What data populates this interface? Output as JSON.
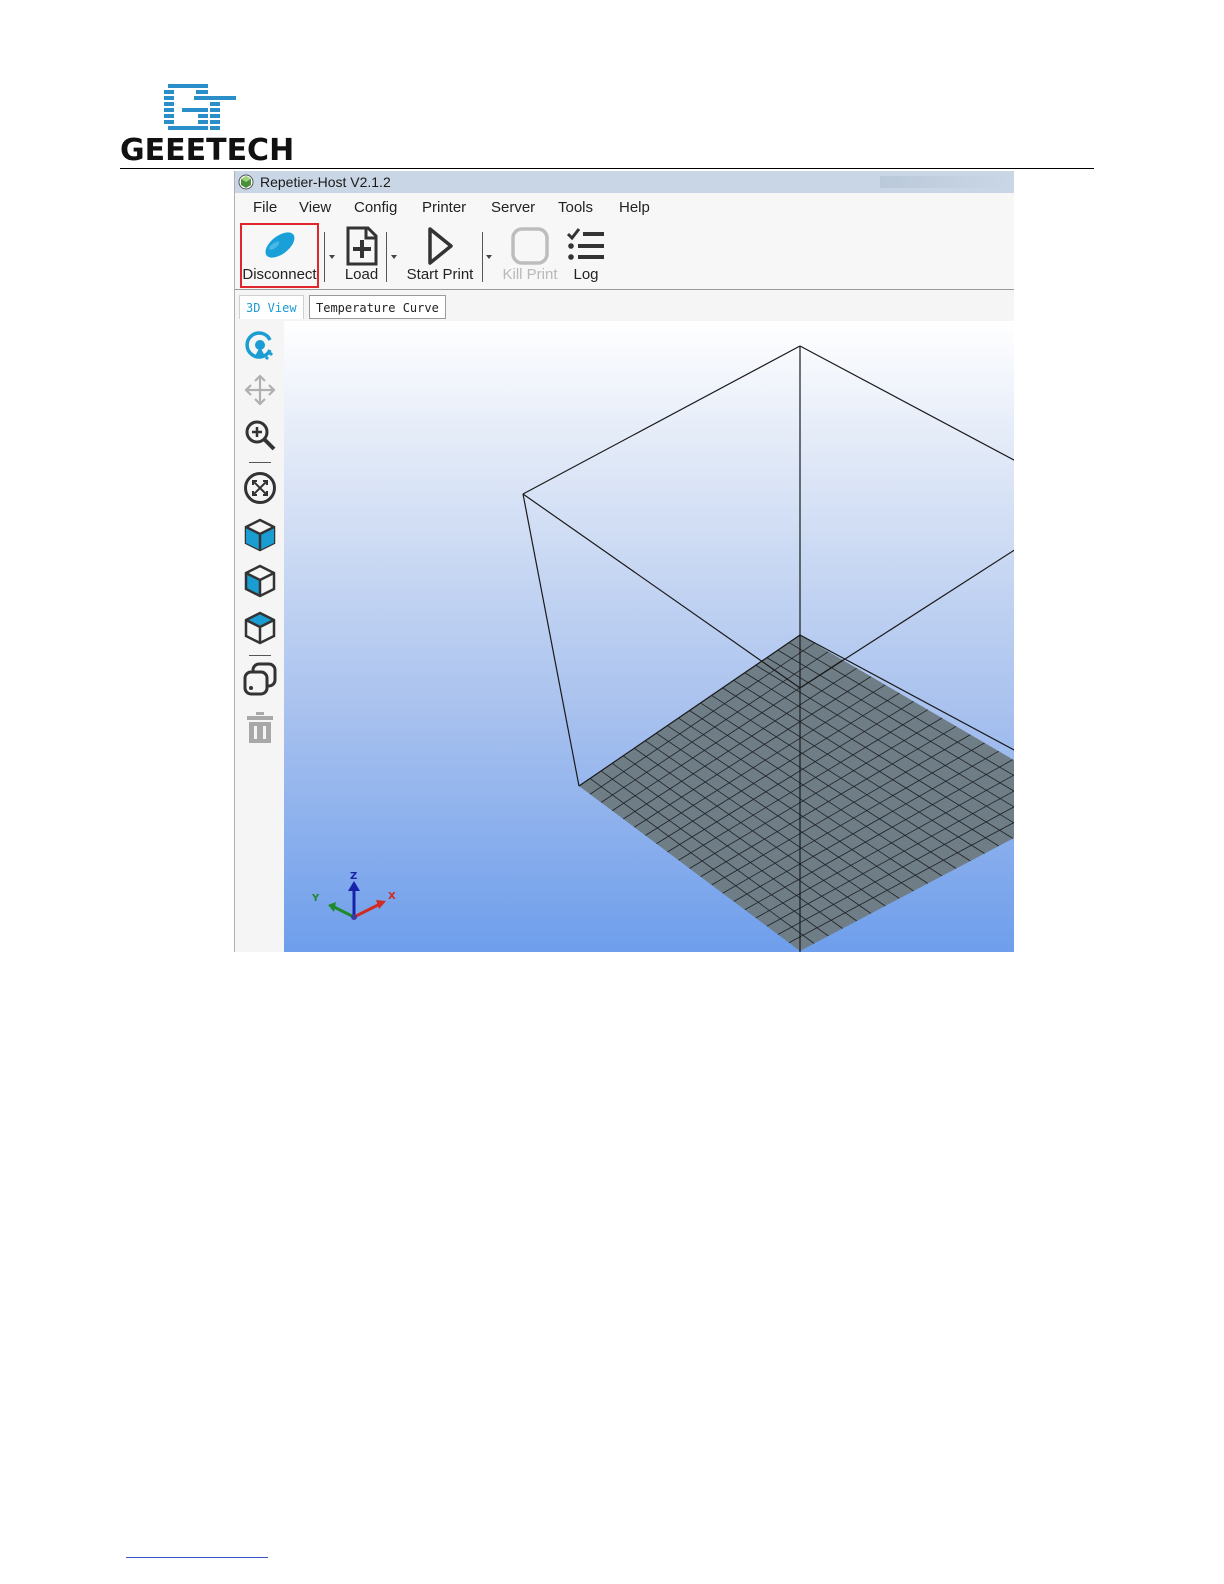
{
  "brand": {
    "name": "GEEETECH"
  },
  "window": {
    "title": "Repetier-Host V2.1.2"
  },
  "menu": {
    "items": [
      "File",
      "View",
      "Config",
      "Printer",
      "Server",
      "Tools",
      "Help"
    ]
  },
  "toolbar": {
    "disconnect_label": "Disconnect",
    "load_label": "Load",
    "start_print_label": "Start Print",
    "kill_print_label": "Kill Print",
    "log_label": "Log"
  },
  "tabs": {
    "view3d": "3D View",
    "temperature": "Temperature Curve"
  },
  "axes": {
    "x": "X",
    "y": "Y",
    "z": "Z"
  },
  "colors": {
    "accent": "#1b9ad2",
    "highlight": "#e0262b",
    "bed": "#6f7d86"
  },
  "sidebar": {
    "icons": [
      "rotate-icon",
      "move-icon",
      "zoom-icon",
      "fit-view-icon",
      "front-view-icon",
      "iso-view-icon",
      "top-view-icon",
      "copy-object-icon",
      "delete-icon"
    ]
  }
}
